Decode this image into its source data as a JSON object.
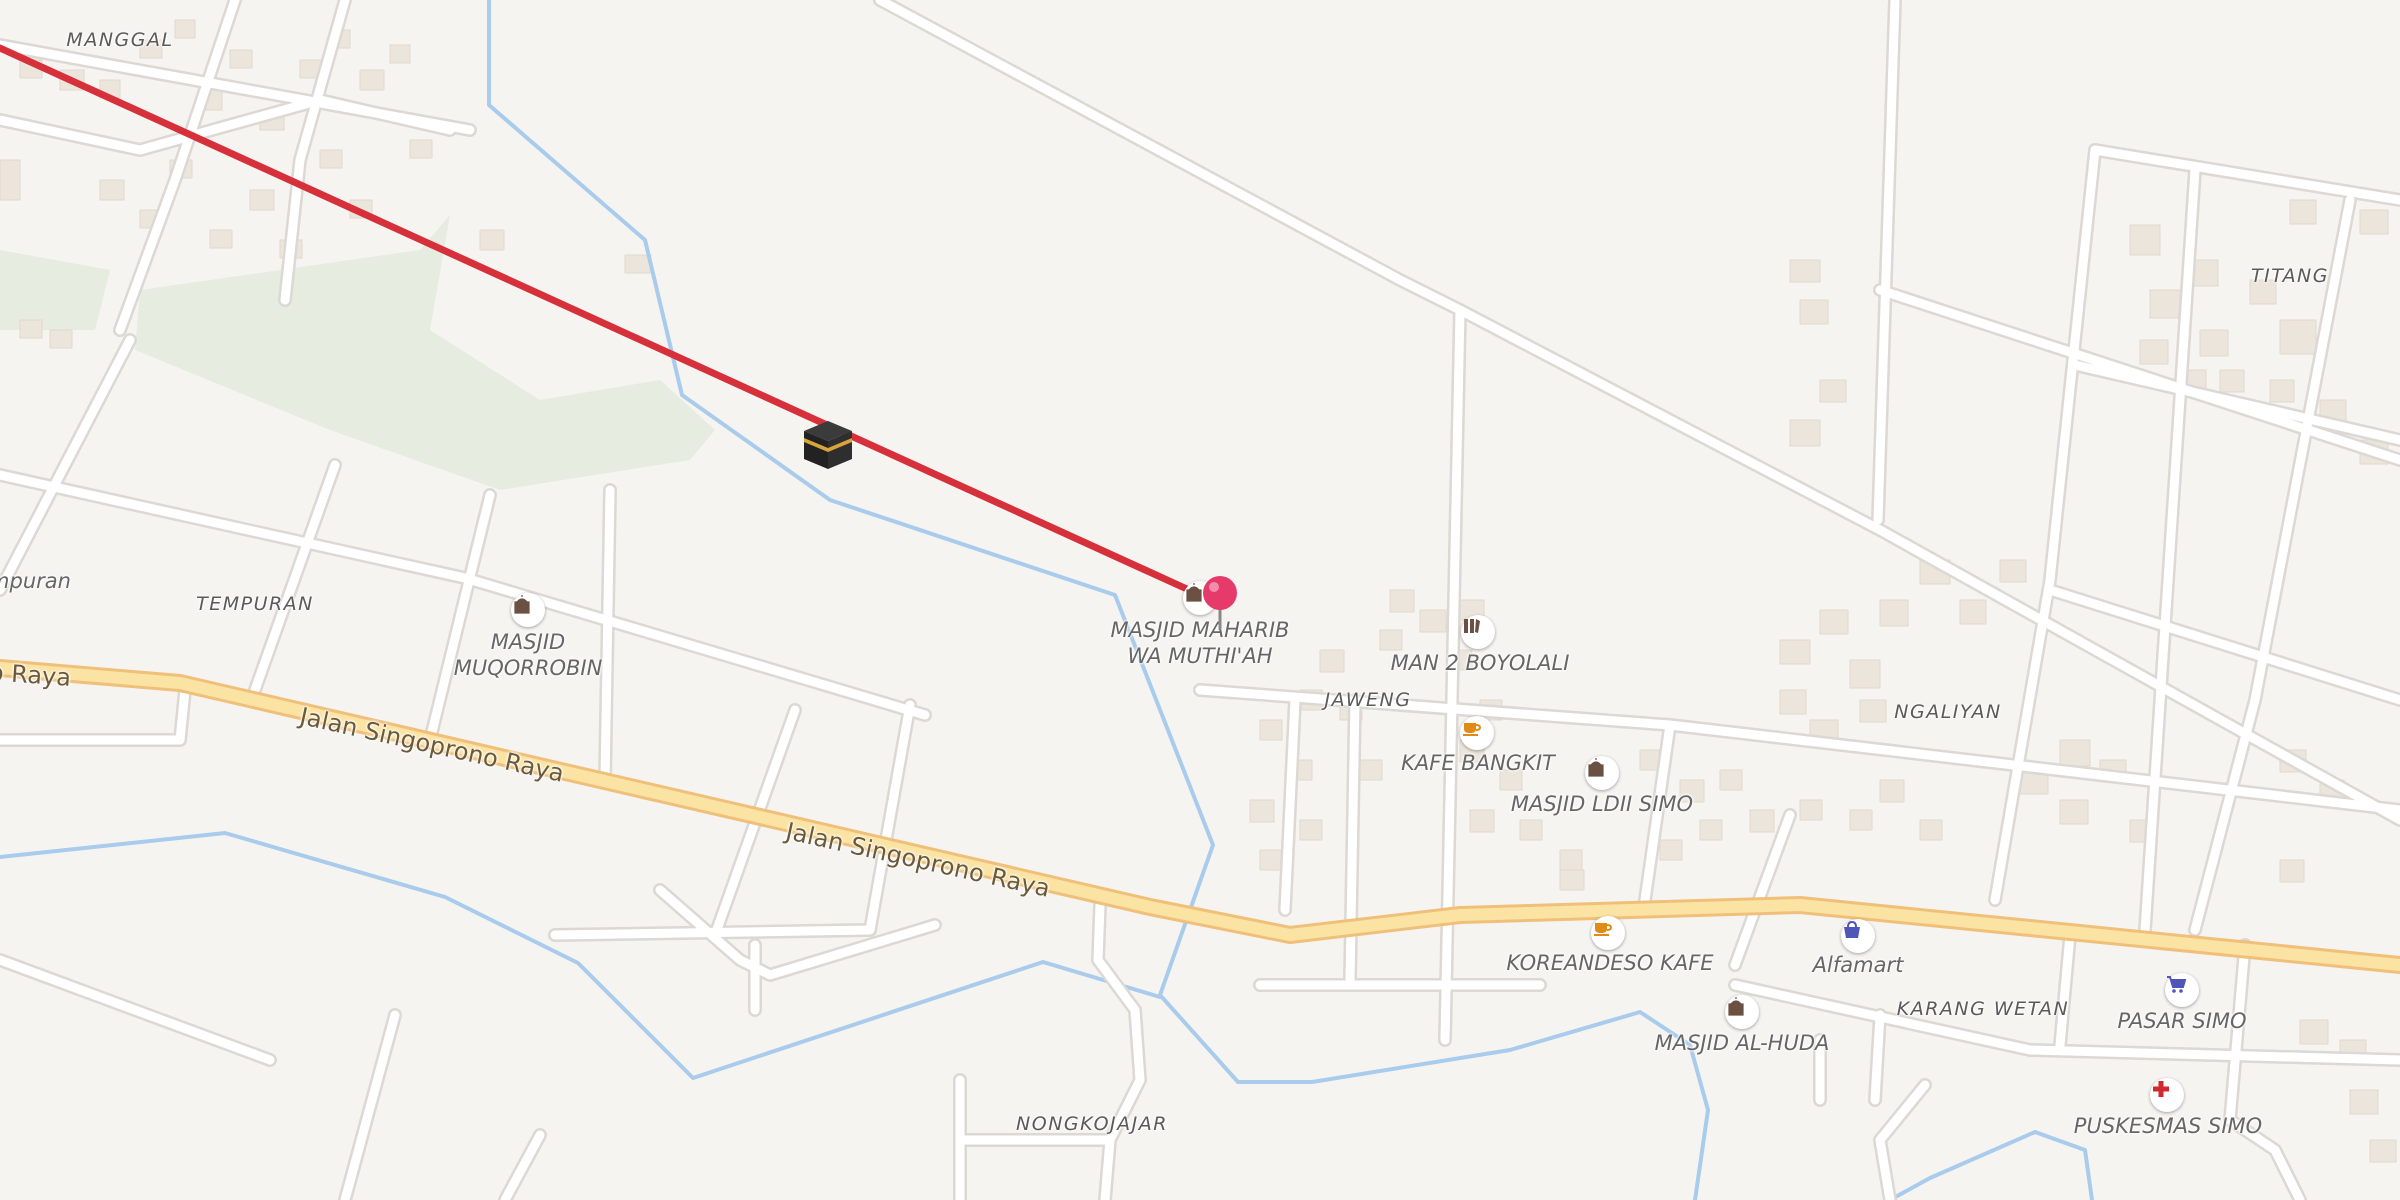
{
  "map": {
    "colors": {
      "background": "#f6f4f1",
      "road": "#ffffff",
      "road_outline": "#dcd8d3",
      "main_road": "#fbe3a4",
      "main_road_outline": "#f0c07a",
      "river": "#a9cbec",
      "park": "#e6ecdf",
      "building": "#ece5dc",
      "qibla_line": "#d6303b",
      "pin": "#e63a6b"
    },
    "places": [
      {
        "id": "manggal",
        "name": "MANGGAL"
      },
      {
        "id": "tempuran",
        "name": "TEMPURAN"
      },
      {
        "id": "tempuran-cut",
        "name": "mpuran"
      },
      {
        "id": "jaweng",
        "name": "JAWENG"
      },
      {
        "id": "titang",
        "name": "TITANG"
      },
      {
        "id": "ngaliyan",
        "name": "NGALIYAN"
      },
      {
        "id": "karang-wetan",
        "name": "KARANG WETAN"
      },
      {
        "id": "nongkojajar",
        "name": "NONGKOJAJAR"
      }
    ],
    "roads": [
      {
        "id": "singoprono-1",
        "name": "Jalan Singoprono Raya"
      },
      {
        "id": "singoprono-2",
        "name": "Jalan Singoprono Raya"
      },
      {
        "id": "raya-cut",
        "name": "o Raya"
      }
    ],
    "pois": [
      {
        "id": "masjid-muqorrobin",
        "name": "MASJID MUQORROBIN",
        "lines": [
          "MASJID",
          "MUQORROBIN"
        ],
        "icon": "mosque-icon"
      },
      {
        "id": "masjid-maharib",
        "name": "MASJID MAHARIB WA MUTHI'AH",
        "lines": [
          "MASJID MAHARIB",
          "WA MUTHI'AH"
        ],
        "icon": "mosque-icon"
      },
      {
        "id": "man2",
        "name": "MAN 2 BOYOLALI",
        "icon": "school-icon"
      },
      {
        "id": "kafe-bangkit",
        "name": "KAFE BANGKIT",
        "icon": "cafe-icon"
      },
      {
        "id": "masjid-ldii",
        "name": "MASJID LDII SIMO",
        "icon": "mosque-icon"
      },
      {
        "id": "koreandeso",
        "name": "KOREANDESO KAFE",
        "icon": "cafe-icon"
      },
      {
        "id": "alfamart",
        "name": "Alfamart",
        "icon": "shopping-bag-icon"
      },
      {
        "id": "masjid-alhuda",
        "name": "MASJID AL-HUDA",
        "icon": "mosque-icon"
      },
      {
        "id": "pasar-simo",
        "name": "PASAR SIMO",
        "icon": "shopping-cart-icon"
      },
      {
        "id": "puskesmas",
        "name": "PUSKESMAS SIMO",
        "icon": "medical-cross-icon"
      }
    ],
    "markers": {
      "location_pin": "location-pin-icon",
      "qibla": "kaaba-icon"
    }
  }
}
